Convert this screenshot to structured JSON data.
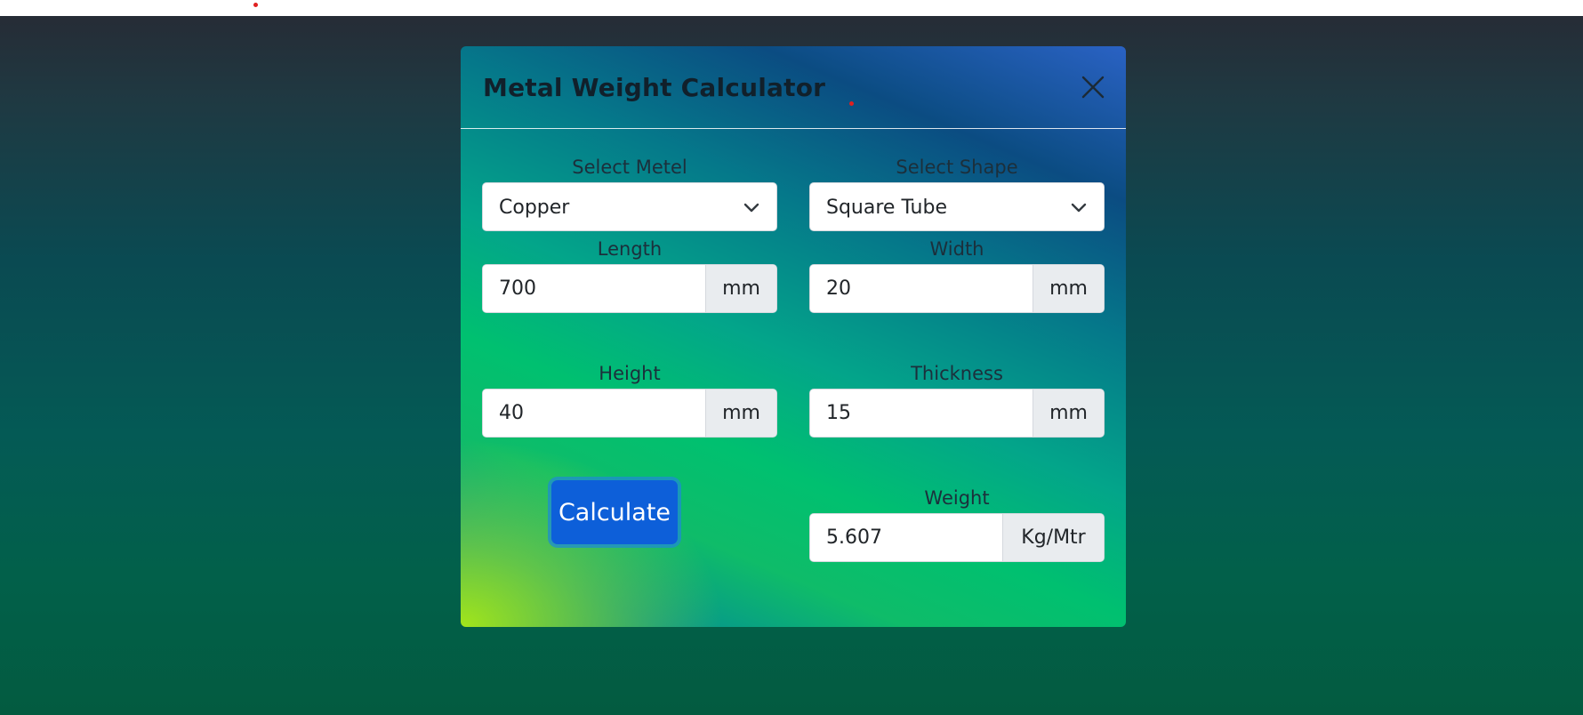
{
  "modal": {
    "title": "Metal Weight Calculator"
  },
  "fields": {
    "metal": {
      "label": "Select Metel",
      "value": "Copper"
    },
    "shape": {
      "label": "Select Shape",
      "value": "Square Tube"
    },
    "length": {
      "label": "Length",
      "value": "700",
      "unit": "mm"
    },
    "width": {
      "label": "Width",
      "value": "20",
      "unit": "mm"
    },
    "height": {
      "label": "Height",
      "value": "40",
      "unit": "mm"
    },
    "thickness": {
      "label": "Thickness",
      "value": "15",
      "unit": "mm"
    },
    "weight": {
      "label": "Weight",
      "value": "5.607",
      "unit": "Kg/Mtr"
    }
  },
  "actions": {
    "calculate_label": "Calculate"
  },
  "icons": {
    "close": "close-icon",
    "dropdown": "chevron-down-icon"
  },
  "colors": {
    "primary_button": "#0d5fd9",
    "addon_bg": "#e9ecef"
  }
}
